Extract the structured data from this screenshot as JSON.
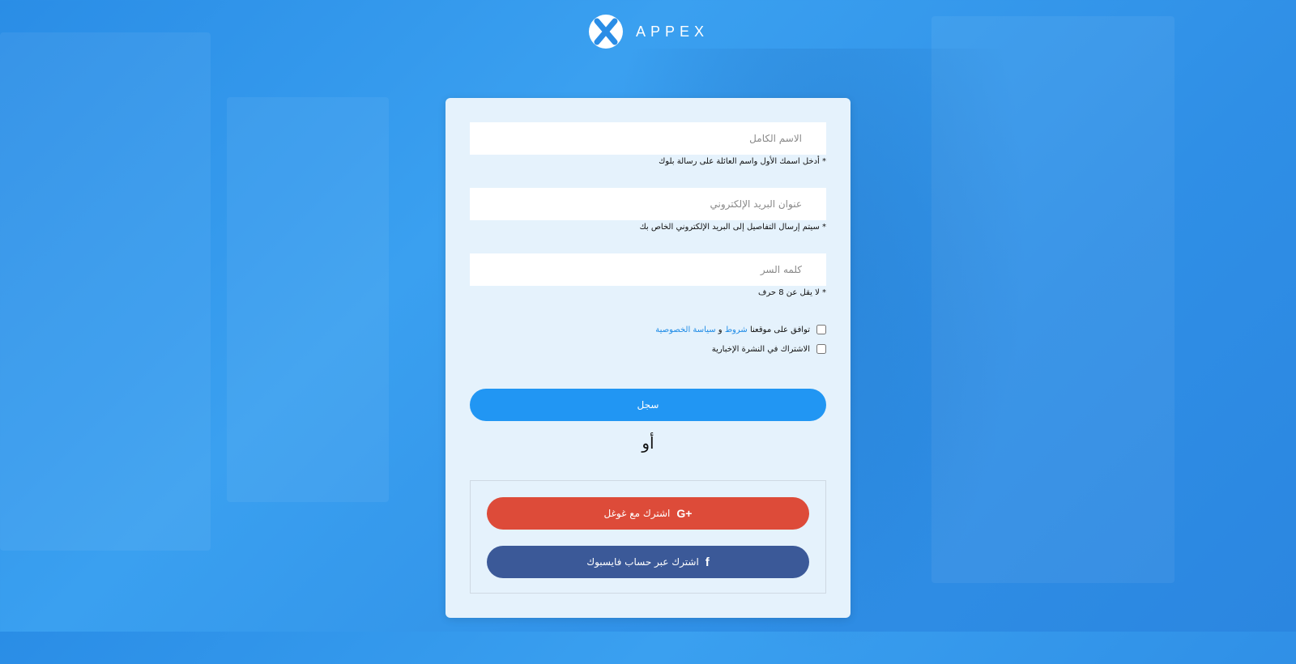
{
  "brand": {
    "name": "APPEX",
    "logo_icon": "appex-x-logo-icon"
  },
  "colors": {
    "accent": "#2196f3",
    "google": "#dd4b39",
    "facebook": "#3b5998",
    "link": "#1e8be6"
  },
  "form": {
    "full_name": {
      "placeholder": "الاسم الكامل",
      "value": "",
      "hint": "* أدخل اسمك الأول واسم العائلة على رسالة بلوك"
    },
    "email": {
      "placeholder": "عنوان البريد الإلكتروني",
      "value": "",
      "hint": "* سيتم إرسال التفاصيل إلى البريد الإلكتروني الخاص بك"
    },
    "password": {
      "placeholder": "كلمه السر",
      "value": "",
      "hint": "* لا يقل عن 8 حرف"
    },
    "agree": {
      "prefix": "توافق على موقعنا",
      "terms_link": "شروط",
      "and": "و",
      "privacy_link": "سياسة الخصوصية",
      "checked": false
    },
    "newsletter": {
      "label": "الاشتراك في النشرة الإخبارية",
      "checked": false
    },
    "register_label": "سجل",
    "or_label": "أو"
  },
  "social": {
    "google_label": "اشترك مع غوغل",
    "google_icon": "google-plus-icon",
    "google_icon_text": "G+",
    "facebook_label": "اشترك عبر حساب فايسبوك",
    "facebook_icon": "facebook-icon",
    "facebook_icon_text": "f"
  }
}
